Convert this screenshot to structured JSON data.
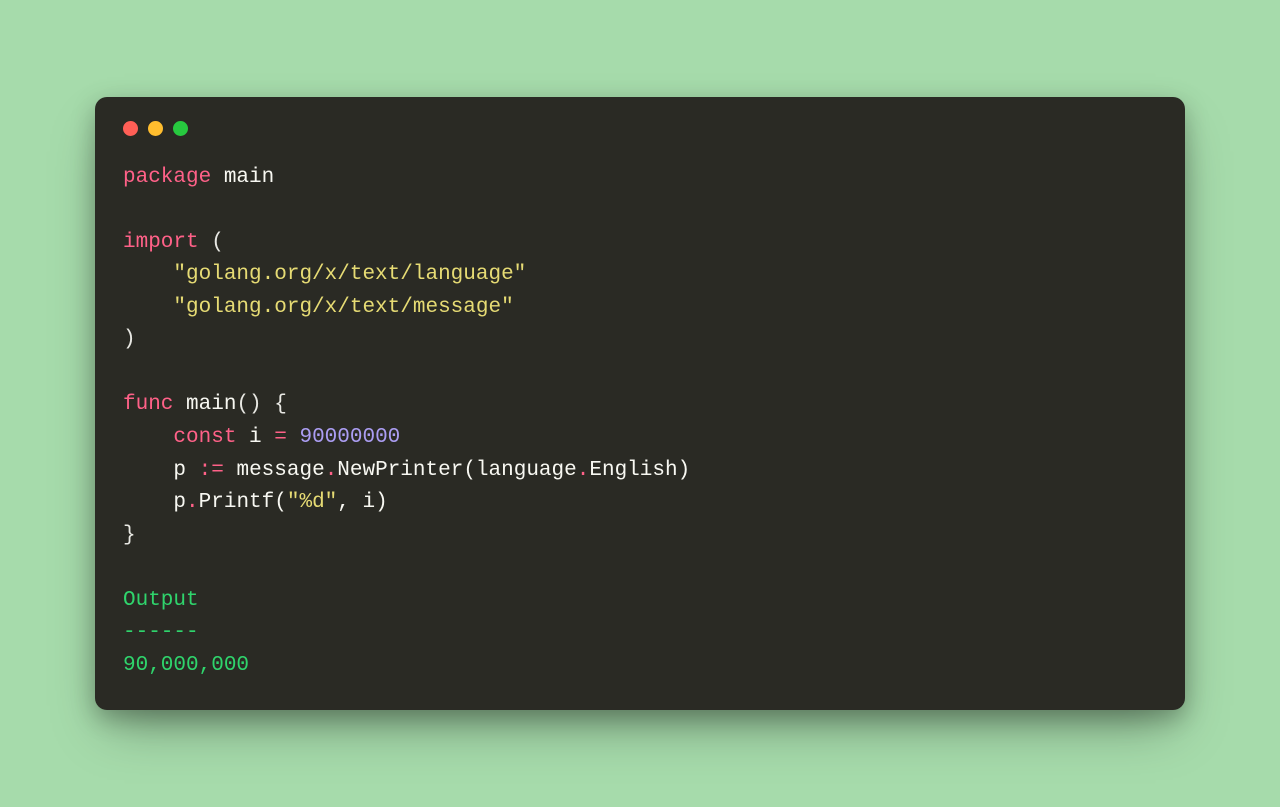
{
  "code": {
    "kw_package": "package",
    "pkg_name": "main",
    "kw_import": "import",
    "paren_open": "(",
    "indent": "    ",
    "import1": "\"golang.org/x/text/language\"",
    "import2": "\"golang.org/x/text/message\"",
    "paren_close": ")",
    "kw_func": "func",
    "fn_name": "main",
    "fn_sig_rest": "() {",
    "kw_const": "const",
    "const_decl_mid": " i ",
    "op_eq": "=",
    "const_val": "90000000",
    "line_p_left": "p ",
    "op_assign": ":=",
    "msg": " message",
    "dot1": ".",
    "newprinter_left": "NewPrinter(language",
    "dot2": ".",
    "newprinter_right": "English)",
    "printf_p": "p",
    "dot3": ".",
    "printf_left": "Printf(",
    "printf_fmt": "\"%d\"",
    "printf_rest": ", i)",
    "brace_close": "}"
  },
  "output": {
    "label": "Output",
    "sep": "------",
    "value": "90,000,000"
  }
}
